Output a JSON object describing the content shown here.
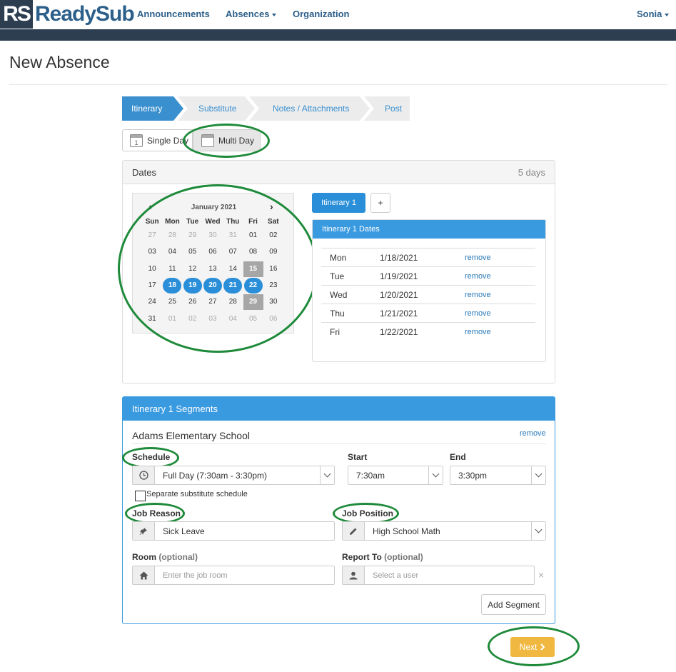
{
  "brand": {
    "rs": "RS",
    "name": "ReadySub"
  },
  "nav": {
    "announcements": "Announcements",
    "absences": "Absences",
    "organization": "Organization",
    "user": "Sonia"
  },
  "page_title": "New Absence",
  "wizard": {
    "steps": [
      "Itinerary",
      "Substitute",
      "Notes / Attachments",
      "Post"
    ],
    "active": "Itinerary"
  },
  "mode": {
    "single": "Single Day",
    "multi": "Multi Day",
    "calendar_day": "1"
  },
  "dates_panel": {
    "title": "Dates",
    "count": "5 days"
  },
  "calendar": {
    "month": "January 2021",
    "weekdays": [
      "Sun",
      "Mon",
      "Tue",
      "Wed",
      "Thu",
      "Fri",
      "Sat"
    ],
    "weeks": [
      [
        "27",
        "28",
        "29",
        "30",
        "31",
        "01",
        "02"
      ],
      [
        "03",
        "04",
        "05",
        "06",
        "07",
        "08",
        "09"
      ],
      [
        "10",
        "11",
        "12",
        "13",
        "14",
        "15",
        "16"
      ],
      [
        "17",
        "18",
        "19",
        "20",
        "21",
        "22",
        "23"
      ],
      [
        "24",
        "25",
        "26",
        "27",
        "28",
        "29",
        "30"
      ],
      [
        "31",
        "01",
        "02",
        "03",
        "04",
        "05",
        "06"
      ]
    ],
    "prev_icon": "chevron-left-icon",
    "next_icon": "chevron-right-icon"
  },
  "itinerary": {
    "tab": "Itinerary 1",
    "add": "+",
    "dates_title": "Itinerary 1 Dates",
    "rows": [
      {
        "day": "Mon",
        "date": "1/18/2021",
        "action": "remove"
      },
      {
        "day": "Tue",
        "date": "1/19/2021",
        "action": "remove"
      },
      {
        "day": "Wed",
        "date": "1/20/2021",
        "action": "remove"
      },
      {
        "day": "Thu",
        "date": "1/21/2021",
        "action": "remove"
      },
      {
        "day": "Fri",
        "date": "1/22/2021",
        "action": "remove"
      }
    ]
  },
  "segments": {
    "title": "Itinerary 1 Segments",
    "school": "Adams Elementary School",
    "remove": "remove",
    "schedule_label": "Schedule",
    "schedule_value": "Full Day (7:30am - 3:30pm)",
    "start_label": "Start",
    "start_value": "7:30am",
    "end_label": "End",
    "end_value": "3:30pm",
    "separate_label": "Separate substitute schedule",
    "reason_label": "Job Reason",
    "reason_value": "Sick Leave",
    "position_label": "Job Position",
    "position_value": "High School Math",
    "room_label": "Room",
    "room_optional": "(optional)",
    "room_placeholder": "Enter the job room",
    "report_label": "Report To",
    "report_optional": "(optional)",
    "report_placeholder": "Select a user",
    "clear": "×",
    "add_segment": "Add Segment"
  },
  "next": "Next",
  "colors": {
    "brand": "#2c3e50",
    "primary": "#2a8fd8",
    "warning": "#f0b840",
    "highlight": "#1e8a3a"
  }
}
